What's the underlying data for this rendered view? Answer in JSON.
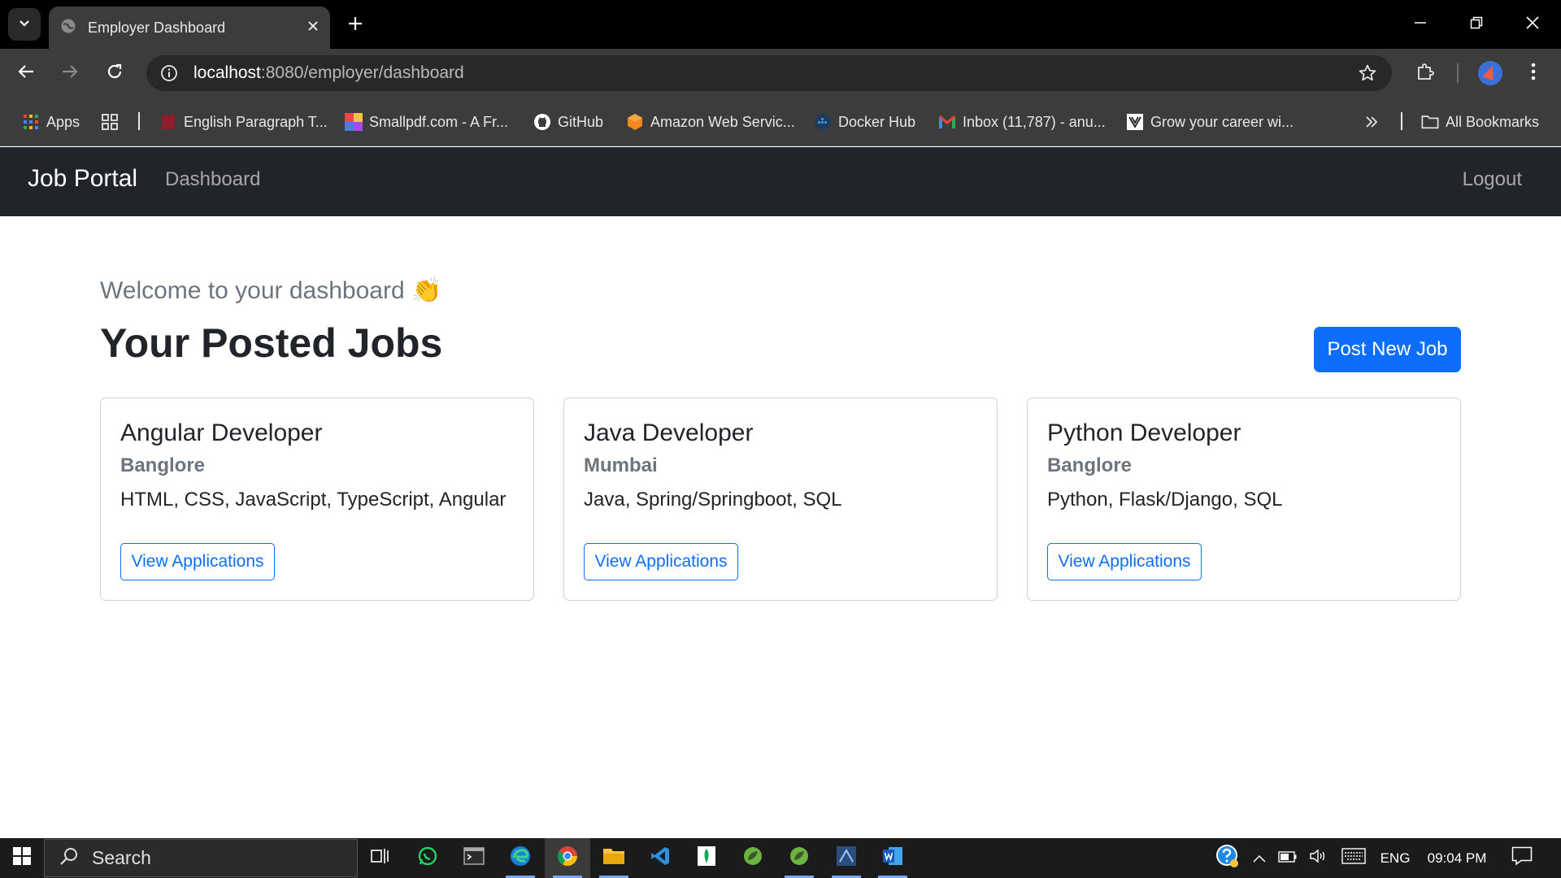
{
  "browser": {
    "tab_title": "Employer Dashboard",
    "url_host": "localhost",
    "url_path": ":8080/employer/dashboard",
    "bookmarks": [
      {
        "label": "Apps",
        "icon": "apps-grid-icon"
      },
      {
        "label": "English Paragraph T...",
        "icon": "doc-icon"
      },
      {
        "label": "Smallpdf.com - A Fr...",
        "icon": "smallpdf-icon"
      },
      {
        "label": "GitHub",
        "icon": "github-icon"
      },
      {
        "label": "Amazon Web Servic...",
        "icon": "aws-icon"
      },
      {
        "label": "Docker Hub",
        "icon": "docker-icon"
      },
      {
        "label": "Inbox (11,787) - anu...",
        "icon": "gmail-icon"
      },
      {
        "label": "Grow your career wi...",
        "icon": "career-icon"
      }
    ],
    "all_bookmarks_label": "All Bookmarks"
  },
  "navbar": {
    "brand": "Job Portal",
    "dashboard_link": "Dashboard",
    "logout_link": "Logout"
  },
  "main": {
    "welcome": "Welcome to your dashboard 👏",
    "heading": "Your Posted Jobs",
    "post_button": "Post New Job",
    "jobs": [
      {
        "title": "Angular Developer",
        "location": "Banglore",
        "skills": "HTML, CSS, JavaScript, TypeScript, Angular",
        "action": "View Applications"
      },
      {
        "title": "Java Developer",
        "location": "Mumbai",
        "skills": "Java, Spring/Springboot, SQL",
        "action": "View Applications"
      },
      {
        "title": "Python Developer",
        "location": "Banglore",
        "skills": "Python, Flask/Django, SQL",
        "action": "View Applications"
      }
    ]
  },
  "taskbar": {
    "search_label": "Search",
    "language": "ENG",
    "time": "09:04 PM"
  },
  "colors": {
    "primary": "#0d6efd",
    "navbar_bg": "#212529",
    "muted": "#6c757d"
  }
}
